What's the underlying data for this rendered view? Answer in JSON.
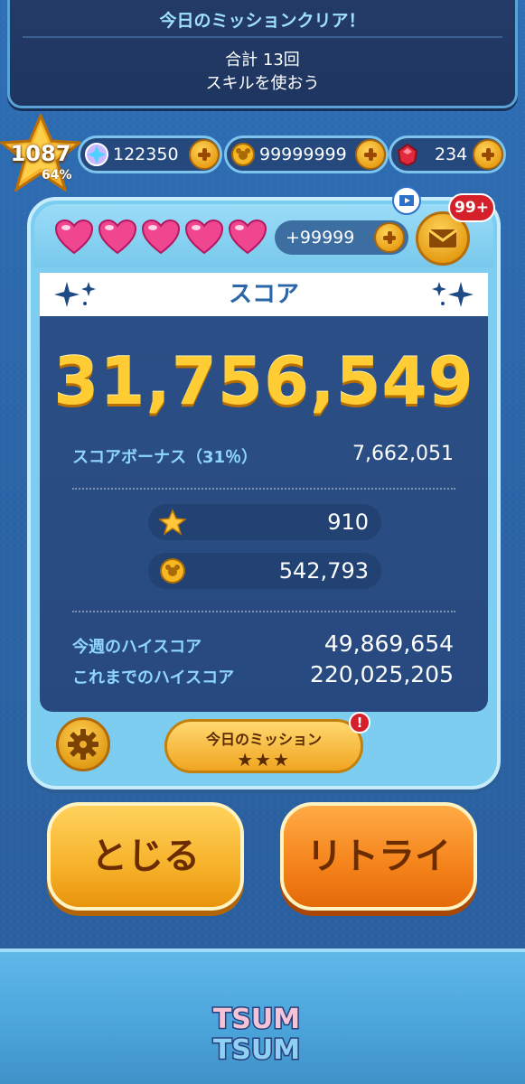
{
  "mission_banner": {
    "title": "今日のミッションクリア！",
    "line1": "合計 13回",
    "line2": "スキルを使おう"
  },
  "level": {
    "number": "1087",
    "progress": "64%"
  },
  "currencies": {
    "gems": "122350",
    "coins": "99999999",
    "rubies": "234"
  },
  "panel": {
    "hearts_count": 5,
    "lives_bonus": "+99999",
    "mail_badge": "99+",
    "score_header": "スコア",
    "score": "31,756,549",
    "bonus_label": "スコアボーナス（31％）",
    "bonus_value": "7,662,051",
    "stars_earned": "910",
    "coins_earned": "542,793",
    "weekly_high_label": "今週のハイスコア",
    "weekly_high_value": "49,869,654",
    "alltime_high_label": "これまでのハイスコア",
    "alltime_high_value": "220,025,205",
    "mission_button": "今日のミッション",
    "mission_stars": "★★★",
    "mission_alert": "!"
  },
  "buttons": {
    "close": "とじる",
    "retry": "リトライ"
  },
  "logo_text": "TSUM TSUM",
  "colors": {
    "score_gold": "#ffcc33",
    "label_blue": "#8fd6ff",
    "background": "#2c66a8"
  }
}
